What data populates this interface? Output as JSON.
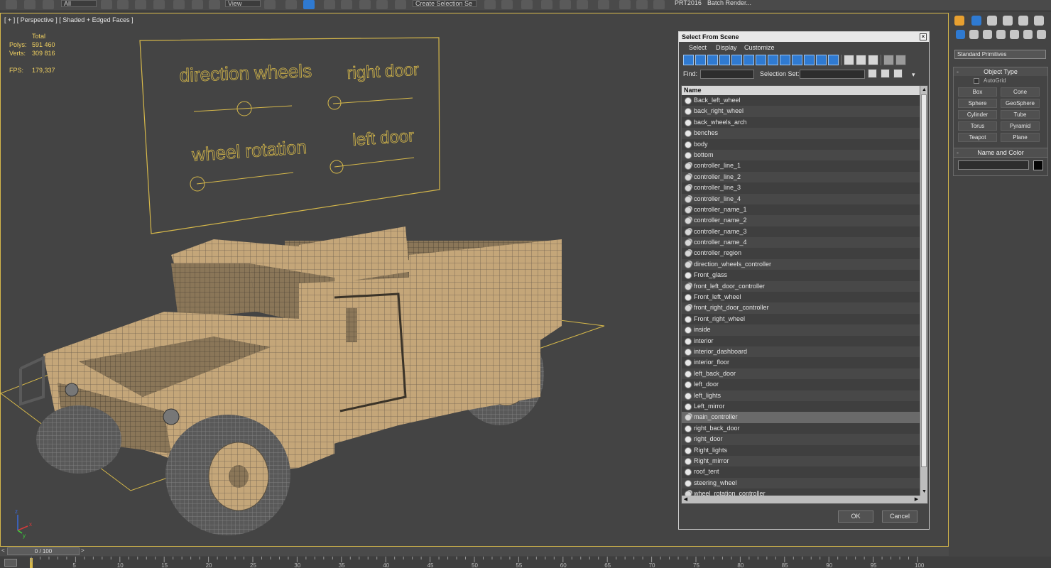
{
  "toolbar": {
    "selection_filter": "All",
    "ref_coord": "View",
    "named_selection": "Create Selection Se",
    "prt_label": "PRT2016",
    "batch_render": "Batch Render..."
  },
  "viewport": {
    "label": "[ + ] [ Perspective ] [ Shaded + Edged Faces ]",
    "stats": {
      "total_label": "Total",
      "polys_label": "Polys:",
      "polys_value": "591 460",
      "verts_label": "Verts:",
      "verts_value": "309 816",
      "fps_label": "FPS:",
      "fps_value": "179,337"
    },
    "scene_labels": {
      "direction_wheels": "direction wheels",
      "right_door": "right door",
      "wheel_rotation": "wheel rotation",
      "left_door": "left door"
    },
    "axis": {
      "x": "x",
      "y": "y",
      "z": "z"
    }
  },
  "dialog": {
    "title": "Select From Scene",
    "close": "×",
    "menu": [
      "Select",
      "Display",
      "Customize"
    ],
    "find_label": "Find:",
    "find_value": "",
    "selection_set_label": "Selection Set:",
    "selection_set_value": "",
    "column_header": "Name",
    "items": [
      {
        "name": "Back_left_wheel",
        "icon": "sphere"
      },
      {
        "name": "back_right_wheel",
        "icon": "sphere"
      },
      {
        "name": "back_wheels_arch",
        "icon": "sphere"
      },
      {
        "name": "benches",
        "icon": "sphere"
      },
      {
        "name": "body",
        "icon": "sphere"
      },
      {
        "name": "bottom",
        "icon": "sphere"
      },
      {
        "name": "controller_line_1",
        "icon": "shape"
      },
      {
        "name": "controller_line_2",
        "icon": "shape"
      },
      {
        "name": "controller_line_3",
        "icon": "shape"
      },
      {
        "name": "controller_line_4",
        "icon": "shape"
      },
      {
        "name": "controller_name_1",
        "icon": "shape"
      },
      {
        "name": "controller_name_2",
        "icon": "shape"
      },
      {
        "name": "controller_name_3",
        "icon": "shape"
      },
      {
        "name": "controller_name_4",
        "icon": "shape"
      },
      {
        "name": "controller_region",
        "icon": "shape"
      },
      {
        "name": "direction_wheels_controller",
        "icon": "shape"
      },
      {
        "name": "Front_glass",
        "icon": "sphere"
      },
      {
        "name": "front_left_door_controller",
        "icon": "shape"
      },
      {
        "name": "Front_left_wheel",
        "icon": "sphere"
      },
      {
        "name": "front_right_door_controller",
        "icon": "shape"
      },
      {
        "name": "Front_right_wheel",
        "icon": "sphere"
      },
      {
        "name": "inside",
        "icon": "sphere"
      },
      {
        "name": "interior",
        "icon": "sphere"
      },
      {
        "name": "interior_dashboard",
        "icon": "sphere"
      },
      {
        "name": "interior_floor",
        "icon": "sphere"
      },
      {
        "name": "left_back_door",
        "icon": "sphere"
      },
      {
        "name": "left_door",
        "icon": "sphere"
      },
      {
        "name": "left_lights",
        "icon": "sphere"
      },
      {
        "name": "Left_mirror",
        "icon": "sphere"
      },
      {
        "name": "main_controller",
        "icon": "shape",
        "selected": true
      },
      {
        "name": "right_back_door",
        "icon": "sphere"
      },
      {
        "name": "right_door",
        "icon": "sphere"
      },
      {
        "name": "Right_lights",
        "icon": "sphere"
      },
      {
        "name": "Right_mirror",
        "icon": "sphere"
      },
      {
        "name": "roof_tent",
        "icon": "sphere"
      },
      {
        "name": "steering_wheel",
        "icon": "sphere"
      },
      {
        "name": "wheel_rotation_controller",
        "icon": "shape"
      }
    ],
    "ok_label": "OK",
    "cancel_label": "Cancel"
  },
  "command_panel": {
    "category_dropdown": "Standard Primitives",
    "object_type_title": "Object Type",
    "autogrid_label": "AutoGrid",
    "object_buttons": [
      "Box",
      "Cone",
      "Sphere",
      "GeoSphere",
      "Cylinder",
      "Tube",
      "Torus",
      "Pyramid",
      "Teapot",
      "Plane"
    ],
    "name_color_title": "Name and Color",
    "collapse_symbol": "-",
    "color": "#050505"
  },
  "timeline": {
    "frame_display": "0 / 100",
    "prev": "<",
    "next": ">",
    "ticks": [
      "5",
      "10",
      "15",
      "20",
      "25",
      "30",
      "35",
      "40",
      "45",
      "50",
      "55",
      "60",
      "65",
      "70",
      "75",
      "80",
      "85",
      "90",
      "95",
      "100"
    ]
  },
  "colors": {
    "viewport_border": "#d6b84a",
    "stats_text": "#f0d060",
    "panel_accent": "#2f7ad1",
    "wire": "#d6b84a",
    "model_fill": "#c4a679"
  }
}
